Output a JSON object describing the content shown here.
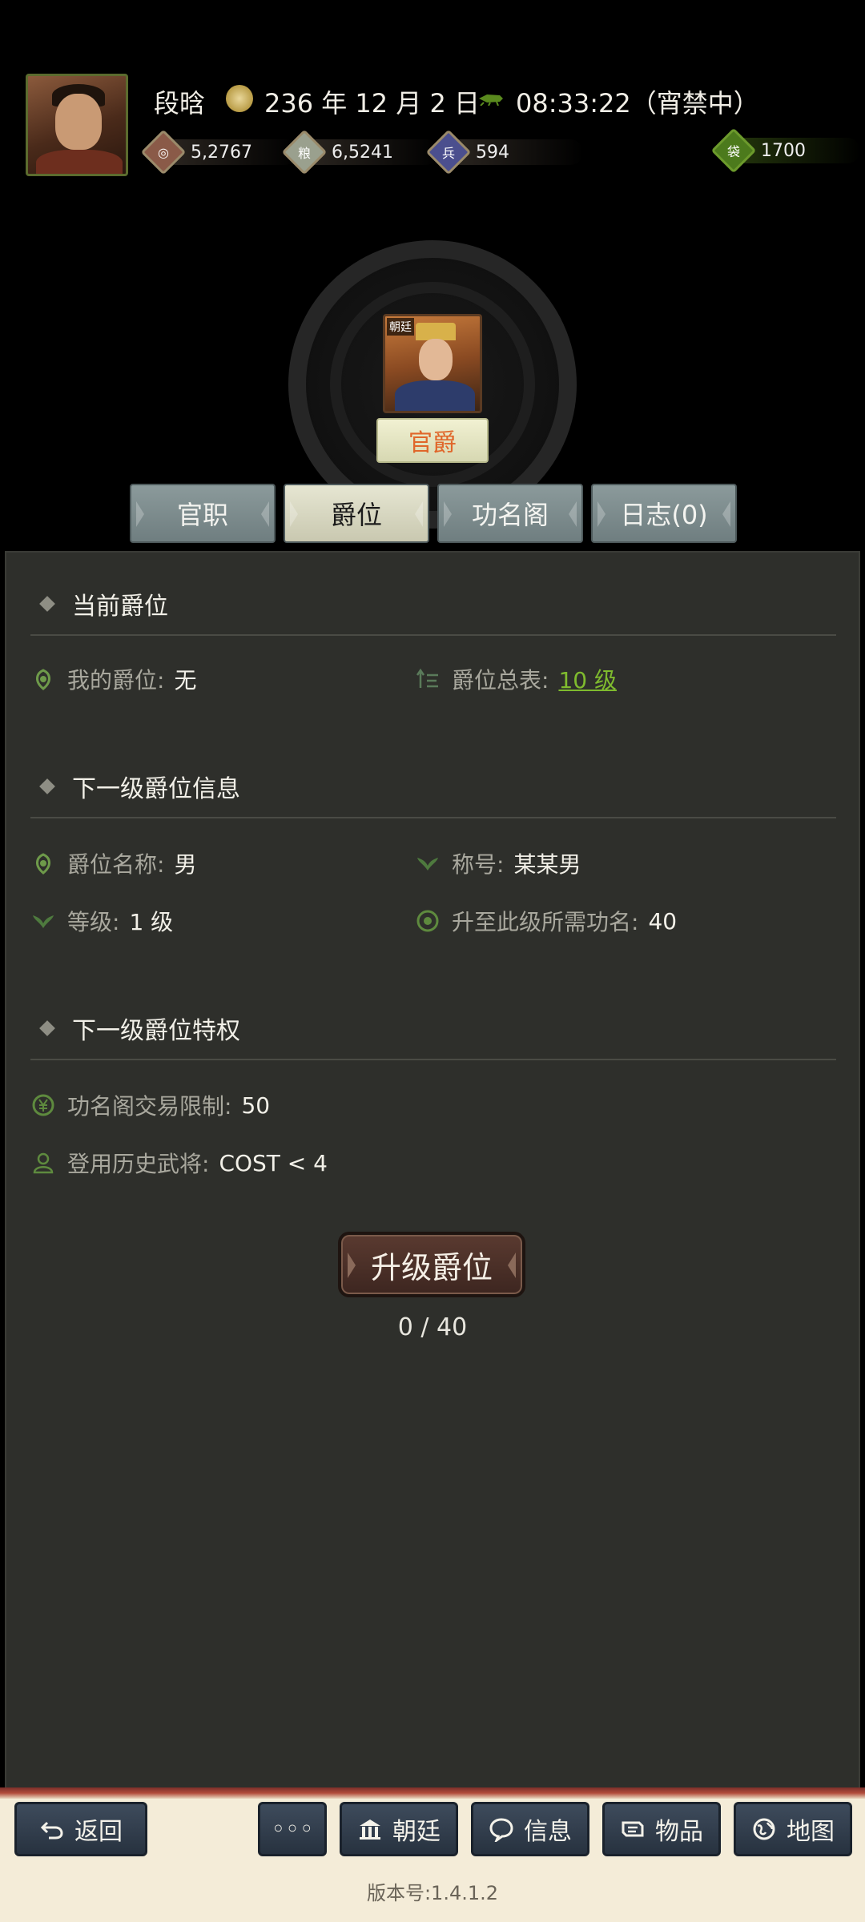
{
  "header": {
    "player_name": "段晗",
    "date": "236 年 12 月 2 日",
    "time": "08:33:22（宵禁中）",
    "resources": [
      {
        "icon": "coin-icon",
        "value": "5,2767",
        "color": "#8a5a48"
      },
      {
        "icon": "grain-icon",
        "value": "6,5241",
        "color": "#9aa08e"
      },
      {
        "icon": "soldier-icon",
        "value": "594",
        "color": "#4b4f8e"
      },
      {
        "icon": "money-bag-icon",
        "value": "1700",
        "color": "#4c7a1c"
      }
    ],
    "court_tag": "朝廷",
    "rank_badge": "官爵"
  },
  "tabs": [
    {
      "label": "官职",
      "active": false
    },
    {
      "label": "爵位",
      "active": true
    },
    {
      "label": "功名阁",
      "active": false
    },
    {
      "label": "日志(0)",
      "active": false
    }
  ],
  "current": {
    "heading": "当前爵位",
    "my_rank_label": "我的爵位:",
    "my_rank_value": "无",
    "rank_table_label": "爵位总表:",
    "rank_table_value": "10 级"
  },
  "next_info": {
    "heading": "下一级爵位信息",
    "name_label": "爵位名称:",
    "name_value": "男",
    "title_label": "称号:",
    "title_value": "某某男",
    "level_label": "等级:",
    "level_value": "1 级",
    "req_label": "升至此级所需功名:",
    "req_value": "40"
  },
  "next_priv": {
    "heading": "下一级爵位特权",
    "trade_label": "功名阁交易限制:",
    "trade_value": "50",
    "general_label": "登用历史武将:",
    "general_value": "COST < 4"
  },
  "upgrade": {
    "button_label": "升级爵位",
    "progress": "0 / 40",
    "current": 0,
    "required": 40
  },
  "bottom_nav": {
    "back": "返回",
    "more": "◦◦◦",
    "court": "朝廷",
    "info": "信息",
    "items": "物品",
    "map": "地图",
    "version": "版本号:1.4.1.2"
  }
}
